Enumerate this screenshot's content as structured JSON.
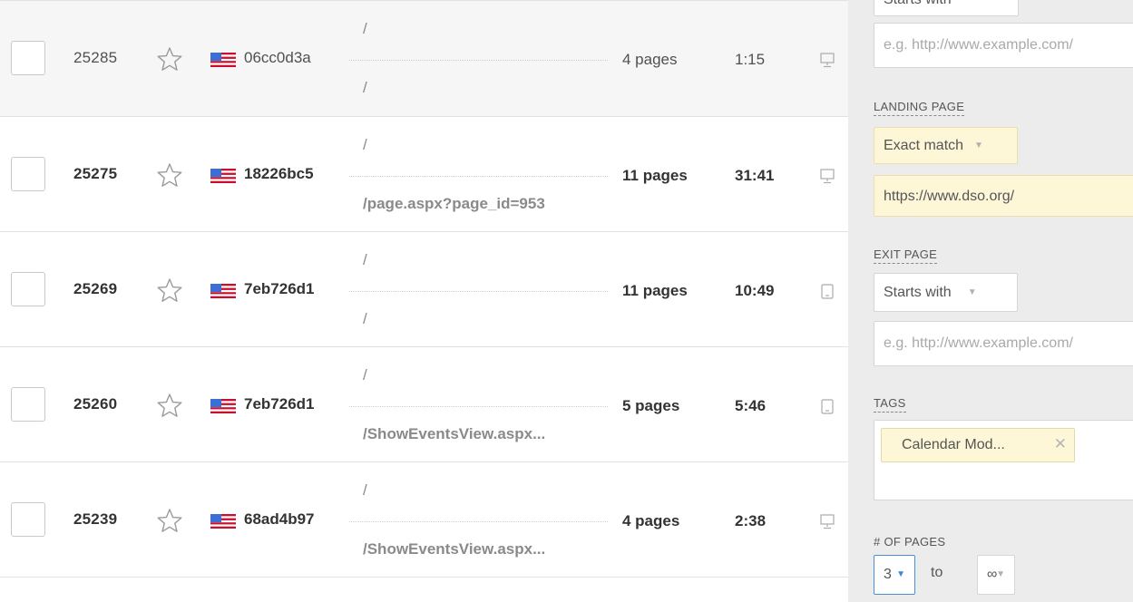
{
  "recordings": [
    {
      "id": "25285",
      "visitor": "06cc0d3a",
      "entry": "/",
      "exit": "/",
      "pages": "4 pages",
      "duration": "1:15",
      "unseen": false,
      "highlight": true,
      "device": "desktop"
    },
    {
      "id": "25275",
      "visitor": "18226bc5",
      "entry": "/",
      "exit": "/page.aspx?page_id=953",
      "pages": "11 pages",
      "duration": "31:41",
      "unseen": true,
      "highlight": false,
      "device": "desktop"
    },
    {
      "id": "25269",
      "visitor": "7eb726d1",
      "entry": "/",
      "exit": "/",
      "pages": "11 pages",
      "duration": "10:49",
      "unseen": true,
      "highlight": false,
      "device": "tablet"
    },
    {
      "id": "25260",
      "visitor": "7eb726d1",
      "entry": "/",
      "exit": "/ShowEventsView.aspx...",
      "pages": "5 pages",
      "duration": "5:46",
      "unseen": true,
      "highlight": false,
      "device": "tablet"
    },
    {
      "id": "25239",
      "visitor": "68ad4b97",
      "entry": "/",
      "exit": "/ShowEventsView.aspx...",
      "pages": "4 pages",
      "duration": "2:38",
      "unseen": true,
      "highlight": false,
      "device": "desktop"
    }
  ],
  "filters": {
    "top_select": "Starts with",
    "top_url_placeholder": "e.g. http://www.example.com/",
    "landing_page": {
      "label": "LANDING PAGE",
      "match": "Exact match",
      "url": "https://www.dso.org/"
    },
    "exit_page": {
      "label": "EXIT PAGE",
      "match": "Starts with",
      "url_placeholder": "e.g. http://www.example.com/"
    },
    "tags": {
      "label": "TAGS",
      "items": [
        "Calendar Mod..."
      ]
    },
    "num_pages": {
      "label": "# OF PAGES",
      "from": "3",
      "to_label": "to",
      "to": "∞"
    }
  },
  "colors": {
    "row_highlight": "#f6f6f6",
    "sidebar_bg": "#ececec",
    "yellow_field": "#fdf7d8",
    "focus_blue": "#4a90d9"
  }
}
